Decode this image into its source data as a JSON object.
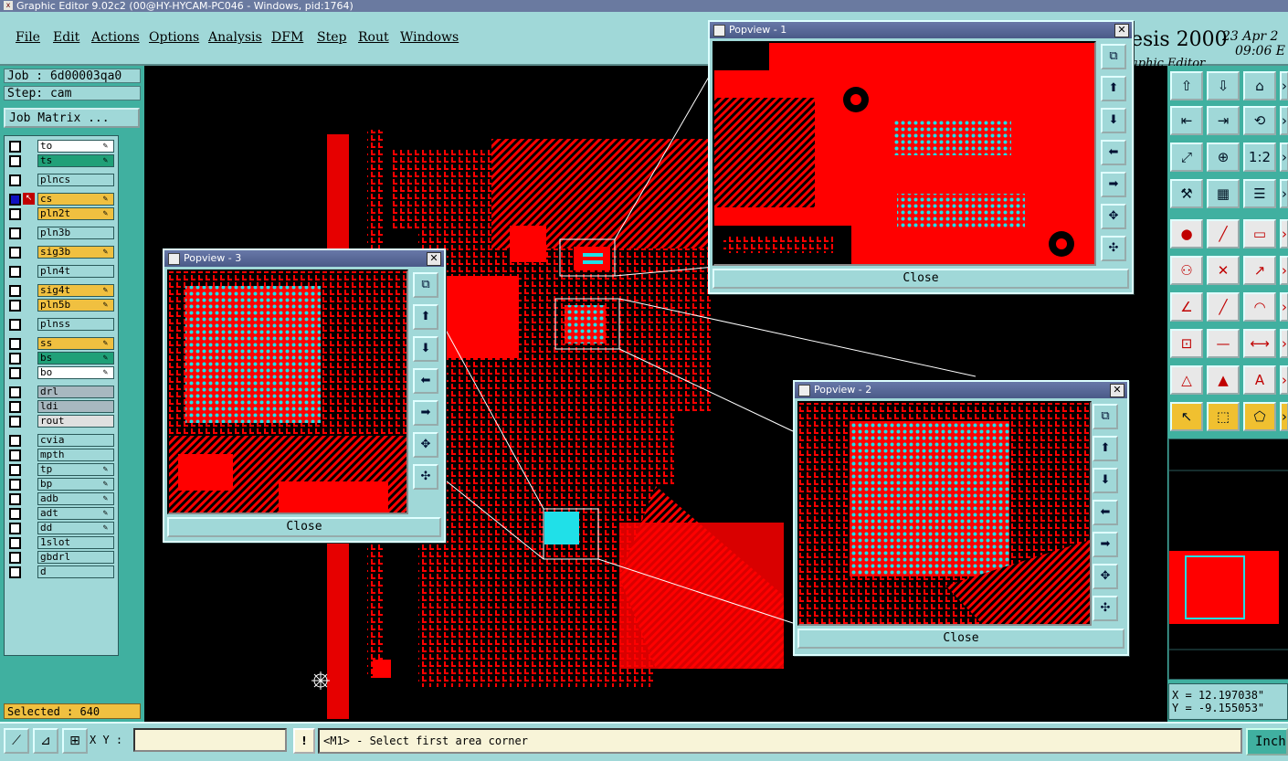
{
  "window": {
    "title": "Graphic Editor 9.02c2 (00@HY-HYCAM-PC046 - Windows, pid:1764)",
    "brand": "esis 2000",
    "brand_sub": "aphic Editor",
    "date": "23 Apr 2",
    "time": "09:06 E"
  },
  "menu": [
    "File",
    "Edit",
    "Actions",
    "Options",
    "Analysis",
    "DFM",
    "Step",
    "Rout",
    "Windows"
  ],
  "job": {
    "job_label": "Job : 6d00003qa0",
    "step_label": "Step: cam",
    "matrix_button": "Job Matrix ..."
  },
  "layers": [
    {
      "name": "to",
      "color": "#ffffff",
      "editable": true
    },
    {
      "name": "ts",
      "color": "#20a078",
      "editable": true
    },
    {
      "name": "plncs",
      "color": "#a0d8d8",
      "editable": false
    },
    {
      "name": "cs",
      "color": "#f0c040",
      "editable": true,
      "work": true
    },
    {
      "name": "pln2t",
      "color": "#f0c040",
      "editable": true
    },
    {
      "name": "pln3b",
      "color": "#a0d8d8",
      "editable": false
    },
    {
      "name": "sig3b",
      "color": "#f0c040",
      "editable": true
    },
    {
      "name": "pln4t",
      "color": "#a0d8d8",
      "editable": false
    },
    {
      "name": "sig4t",
      "color": "#f0c040",
      "editable": true
    },
    {
      "name": "pln5b",
      "color": "#f0c040",
      "editable": true
    },
    {
      "name": "plnss",
      "color": "#a0d8d8",
      "editable": false
    },
    {
      "name": "ss",
      "color": "#f0c040",
      "editable": true
    },
    {
      "name": "bs",
      "color": "#20a078",
      "editable": true
    },
    {
      "name": "bo",
      "color": "#ffffff",
      "editable": true
    },
    {
      "name": "drl",
      "color": "#a8b8c0",
      "editable": false
    },
    {
      "name": "ldi",
      "color": "#a8b8c0",
      "editable": false
    },
    {
      "name": "rout",
      "color": "#e0e0e0",
      "editable": false
    },
    {
      "name": "cvia",
      "color": "#a0d8d8",
      "editable": false
    },
    {
      "name": "mpth",
      "color": "#a0d8d8",
      "editable": false
    },
    {
      "name": "tp",
      "color": "#a0d8d8",
      "editable": true
    },
    {
      "name": "bp",
      "color": "#a0d8d8",
      "editable": true
    },
    {
      "name": "adb",
      "color": "#a0d8d8",
      "editable": true
    },
    {
      "name": "adt",
      "color": "#a0d8d8",
      "editable": true
    },
    {
      "name": "dd",
      "color": "#a0d8d8",
      "editable": true
    },
    {
      "name": "1slot",
      "color": "#a0d8d8",
      "editable": false
    },
    {
      "name": "gbdrl",
      "color": "#a0d8d8",
      "editable": false
    },
    {
      "name": "d",
      "color": "#a0d8d8",
      "editable": false
    }
  ],
  "selected_label": "Selected : 640",
  "popviews": {
    "p1": {
      "title": "Popview - 1",
      "close": "Close"
    },
    "p2": {
      "title": "Popview - 2",
      "close": "Close"
    },
    "p3": {
      "title": "Popview - 3",
      "close": "Close"
    }
  },
  "coords": {
    "x_label": "X = 12.197038\"",
    "y_label": "Y = -9.155053\""
  },
  "status": {
    "xy_label": "X Y :",
    "xy_value": "",
    "info_button": "!",
    "message": "<M1> - Select first area corner",
    "unit_button": "Inch"
  },
  "colors": {
    "board": "#ff0000",
    "pad": "#20e0e8",
    "panel": "#a0d8d8",
    "panel_dark": "#40b0a0"
  }
}
